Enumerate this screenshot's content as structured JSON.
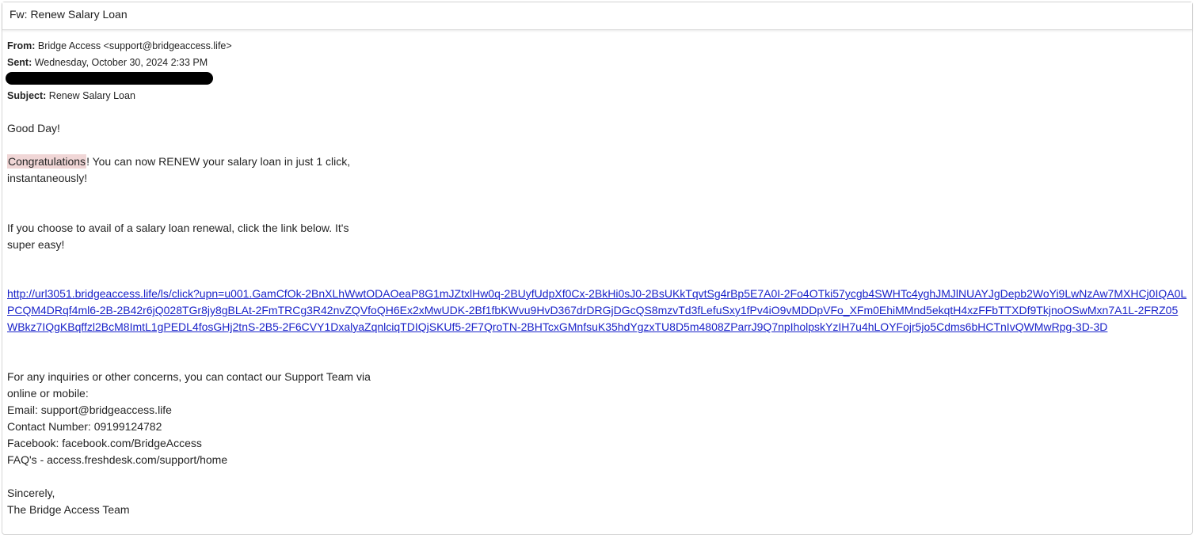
{
  "subject_bar": {
    "title": "Fw: Renew Salary Loan"
  },
  "headers": {
    "from_label": "From:",
    "from_value": "Bridge Access <support@bridgeaccess.life>",
    "sent_label": "Sent:",
    "sent_value": "Wednesday, October 30, 2024 2:33 PM",
    "subject_label": "Subject:",
    "subject_value": "Renew Salary Loan"
  },
  "body": {
    "greeting": "Good Day!",
    "congrats_word": "Congratulations",
    "congrats_line1_rest": "!  You can now RENEW your salary loan in just 1 click,",
    "congrats_line2": "instantaneously!",
    "avail_line1": "If you choose to avail of a salary loan renewal, click the link below. It's",
    "avail_line2": "super easy!",
    "link": "http://url3051.bridgeaccess.life/ls/click?upn=u001.GamCfOk-2BnXLhWwtODAOeaP8G1mJZtxlHw0q-2BUyfUdpXf0Cx-2BkHi0sJ0-2BsUKkTqvtSg4rBp5E7A0I-2Fo4OTki57ycgb4SWHTc4yghJMJlNUAYJgDepb2WoYi9LwNzAw7MXHCj0IQA0LPCQM4DRqf4ml6-2B-2B42r6jQ028TGr8jy8gBLAt-2FmTRCg3R42nvZQVfoQH6Ex2xMwUDK-2Bf1fbKWvu9HvD367drDRGjDGcQS8mzvTd3fLefuSxy1fPv4iO9vMDDpVFo_XFm0EhiMMnd5ekqtH4xzFFbTTXDf9TkjnoOSwMxn7A1L-2FRZ05WBkz7IQgKBqffzl2BcM8ImtL1gPEDL4fosGHj2tnS-2B5-2F6CVY1DxalyaZqnlciqTDIQjSKUf5-2F7QroTN-2BHTcxGMnfsuK35hdYgzxTU8D5m4808ZParrJ9Q7npIholpskYzIH7u4hLOYFojr5jo5Cdms6bHCTnIvQWMwRpg-3D-3D",
    "inquiry_line1": "For any inquiries or other concerns, you can contact our Support Team via",
    "inquiry_line2": "online or mobile:",
    "email_line": "Email: support@bridgeaccess.life",
    "contact_line": "Contact Number: 09199124782",
    "facebook_line": "Facebook: facebook.com/BridgeAccess",
    "faq_line": "FAQ's - access.freshdesk.com/support/home",
    "signoff": "Sincerely,",
    "signature": "The Bridge Access Team"
  },
  "colors": {
    "link": "#1a23c9",
    "highlight": "#f0d6d6",
    "redaction": "#000000"
  }
}
